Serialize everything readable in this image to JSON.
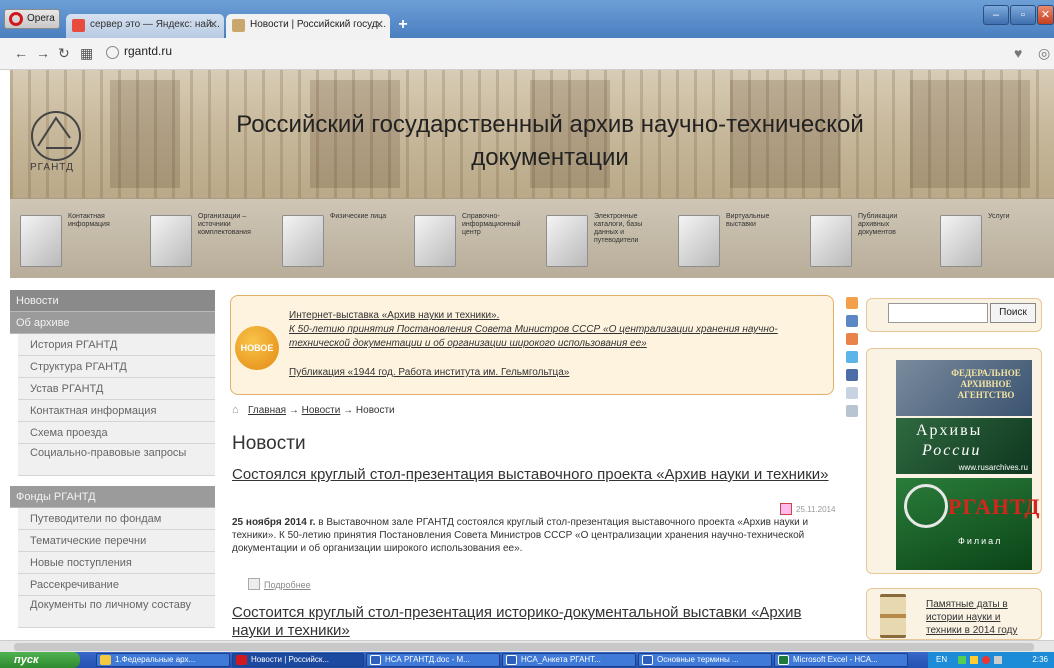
{
  "browser": {
    "menu_label": "Opera",
    "tabs": [
      {
        "label": "сервер это — Яндекс: най...",
        "close": "✕"
      },
      {
        "label": "Новости | Российский госуд...",
        "close": "✕"
      }
    ],
    "new_tab": "+",
    "address": "rgantd.ru",
    "window_buttons": {
      "min": "–",
      "max": "▫",
      "close": "✕"
    }
  },
  "header": {
    "title": "Российский государственный архив научно-технической документации",
    "logo_text": "РГАНТД"
  },
  "icon_nav": [
    {
      "label": "Контактная информация"
    },
    {
      "label": "Организации – источники комплектования"
    },
    {
      "label": "Физические лица"
    },
    {
      "label": "Справочно-информационный центр"
    },
    {
      "label": "Электронные каталоги, базы данных и путеводители"
    },
    {
      "label": "Виртуальные выставки"
    },
    {
      "label": "Публикации архивных документов"
    },
    {
      "label": "Услуги"
    }
  ],
  "sidebar": {
    "items": [
      {
        "label": "Новости"
      },
      {
        "label": "Об архиве"
      },
      {
        "label": "История РГАНТД"
      },
      {
        "label": "Структура РГАНТД"
      },
      {
        "label": "Устав РГАНТД"
      },
      {
        "label": "Контактная информация"
      },
      {
        "label": "Схема проезда"
      },
      {
        "label": "Социально-правовые запросы"
      },
      {
        "label": "Фонды РГАНТД"
      },
      {
        "label": "Путеводители по фондам"
      },
      {
        "label": "Тематические перечни"
      },
      {
        "label": "Новые поступления"
      },
      {
        "label": "Рассекречивание"
      },
      {
        "label": "Документы по личному составу"
      }
    ]
  },
  "newsbox": {
    "badge": "НОВОЕ",
    "link1": "Интернет-выставка «Архив науки и техники».",
    "link2": "К 50-летию принятия Постановления Совета Министров СССР «О централизации хранения научно-технической документации и об организации широкого использования ее»",
    "link3": "Публикация «1944 год. Работа института им. Гельмгольтца»"
  },
  "breadcrumb": {
    "home": "Главная",
    "sep1": "→",
    "news": "Новости",
    "sep2": "→",
    "current": "Новости"
  },
  "main": {
    "page_title": "Новости",
    "article1": {
      "title": "Состоялся круглый стол-презентация выставочного проекта «Архив науки и техники»",
      "date": "25.11.2014",
      "lead_bold": "25 ноября 2014 г.",
      "text": " в Выставочном зале РГАНТД состоялся круглый стол-презентация выставочного проекта «Архив науки и техники». К 50-летию принятия Постановления Совета Министров СССР «О централизации хранения научно-технической документации и об организации широкого использования ее».",
      "more": "Подробнее"
    },
    "article2": {
      "title": "Состоится круглый стол-презентация историко-документальной выставки «Архив науки и техники»"
    }
  },
  "search": {
    "placeholder": "",
    "button": "Поиск"
  },
  "banners": {
    "fed_archive": "ФЕДЕРАЛЬНОЕ АРХИВНОЕ АГЕНТСТВО",
    "archives_line1": "Архивы",
    "archives_line2": "России",
    "archives_url": "www.rusarchives.ru",
    "rgantd": "РГАНТД",
    "rgantd_sub": "Филиал"
  },
  "dates": {
    "link": "Памятные даты в истории науки и техники в 2014 году"
  },
  "taskbar": {
    "start": "пуск",
    "tasks": [
      {
        "label": "1.Федеральные арх..."
      },
      {
        "label": "Новости | Российск..."
      },
      {
        "label": "НСА РГАНТД.doc - М..."
      },
      {
        "label": "НСА_Анкета РГАНТ..."
      },
      {
        "label": "Основные термины ..."
      },
      {
        "label": "Microsoft Excel - НСА..."
      }
    ],
    "tray_lang": "EN",
    "clock": "2:36"
  }
}
